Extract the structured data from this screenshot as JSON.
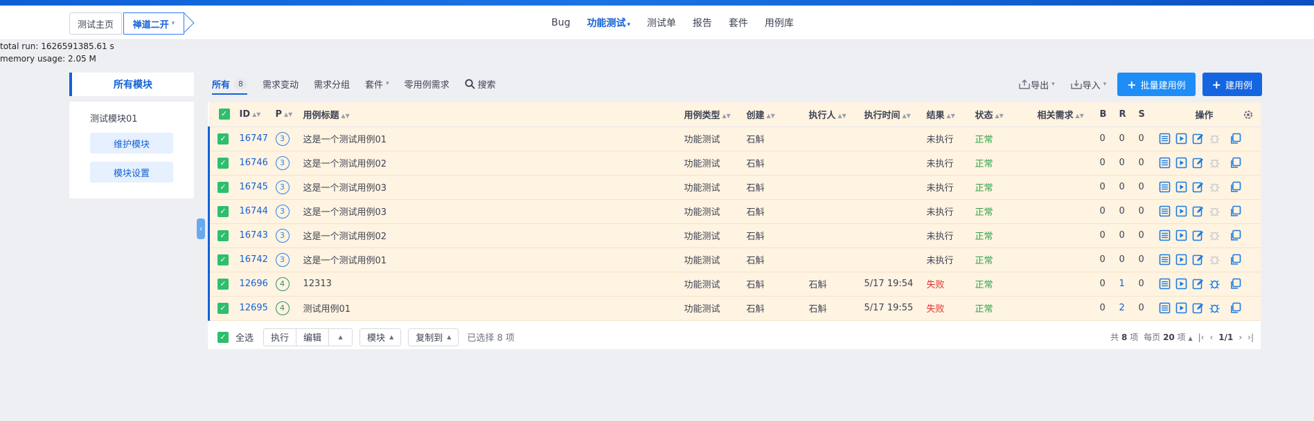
{
  "breadcrumb": {
    "home": "测试主页",
    "project": "禅道二开"
  },
  "nav": [
    {
      "label": "Bug",
      "active": false,
      "dropdown": false
    },
    {
      "label": "功能测试",
      "active": true,
      "dropdown": true
    },
    {
      "label": "测试单",
      "active": false,
      "dropdown": false
    },
    {
      "label": "报告",
      "active": false,
      "dropdown": false
    },
    {
      "label": "套件",
      "active": false,
      "dropdown": false
    },
    {
      "label": "用例库",
      "active": false,
      "dropdown": false
    }
  ],
  "debug": {
    "total_run": "total run: 1626591385.61 s",
    "memory": "memory usage: 2.05 M"
  },
  "sidebar": {
    "tab": "所有模块",
    "module": "测试模块01",
    "maintain_button": "维护模块",
    "settings_button": "模块设置"
  },
  "tabs": {
    "all": "所有",
    "all_count": "8",
    "story_change": "需求变动",
    "story_group": "需求分组",
    "suite": "套件",
    "zero_case": "零用例需求",
    "search": "搜索"
  },
  "actions": {
    "export": "导出",
    "import": "导入",
    "batch_create": "批量建用例",
    "create": "建用例"
  },
  "table": {
    "headers": {
      "id": "ID",
      "pri": "P",
      "title": "用例标题",
      "type": "用例类型",
      "creator": "创建",
      "executor": "执行人",
      "exec_time": "执行时间",
      "result": "结果",
      "status": "状态",
      "story": "相关需求",
      "b": "B",
      "r": "R",
      "s": "S",
      "ops": "操作"
    },
    "rows": [
      {
        "id": "16747",
        "pri": "3",
        "title": "这是一个测试用例01",
        "type": "功能测试",
        "creator": "石斛",
        "executor": "",
        "exec_time": "",
        "result": "未执行",
        "status": "正常",
        "b": "0",
        "r": "0",
        "s": "0"
      },
      {
        "id": "16746",
        "pri": "3",
        "title": "这是一个测试用例02",
        "type": "功能测试",
        "creator": "石斛",
        "executor": "",
        "exec_time": "",
        "result": "未执行",
        "status": "正常",
        "b": "0",
        "r": "0",
        "s": "0"
      },
      {
        "id": "16745",
        "pri": "3",
        "title": "这是一个测试用例03",
        "type": "功能测试",
        "creator": "石斛",
        "executor": "",
        "exec_time": "",
        "result": "未执行",
        "status": "正常",
        "b": "0",
        "r": "0",
        "s": "0"
      },
      {
        "id": "16744",
        "pri": "3",
        "title": "这是一个测试用例03",
        "type": "功能测试",
        "creator": "石斛",
        "executor": "",
        "exec_time": "",
        "result": "未执行",
        "status": "正常",
        "b": "0",
        "r": "0",
        "s": "0"
      },
      {
        "id": "16743",
        "pri": "3",
        "title": "这是一个测试用例02",
        "type": "功能测试",
        "creator": "石斛",
        "executor": "",
        "exec_time": "",
        "result": "未执行",
        "status": "正常",
        "b": "0",
        "r": "0",
        "s": "0"
      },
      {
        "id": "16742",
        "pri": "3",
        "title": "这是一个测试用例01",
        "type": "功能测试",
        "creator": "石斛",
        "executor": "",
        "exec_time": "",
        "result": "未执行",
        "status": "正常",
        "b": "0",
        "r": "0",
        "s": "0"
      },
      {
        "id": "12696",
        "pri": "4",
        "title": "12313",
        "type": "功能测试",
        "creator": "石斛",
        "executor": "石斛",
        "exec_time": "5/17 19:54",
        "result": "失败",
        "status": "正常",
        "b": "0",
        "r": "1",
        "s": "0"
      },
      {
        "id": "12695",
        "pri": "4",
        "title": "测试用例01",
        "type": "功能测试",
        "creator": "石斛",
        "executor": "石斛",
        "exec_time": "5/17 19:55",
        "result": "失败",
        "status": "正常",
        "b": "0",
        "r": "2",
        "s": "0"
      }
    ]
  },
  "footer": {
    "select_all": "全选",
    "execute": "执行",
    "edit": "编辑",
    "module": "模块",
    "copy_to": "复制到",
    "selected": "已选择 8 项"
  },
  "pager": {
    "total_prefix": "共",
    "total": "8",
    "total_suffix": "项",
    "per_page_prefix": "每页",
    "per_page": "20",
    "per_page_suffix": "项",
    "page": "1/1"
  },
  "colors": {
    "brand": "#1261d6",
    "primary_button": "#1e8df8",
    "row_bg": "#fff3e1",
    "ok": "#2fa24c",
    "fail": "#e0312f",
    "checkbox": "#2fbd6e"
  }
}
